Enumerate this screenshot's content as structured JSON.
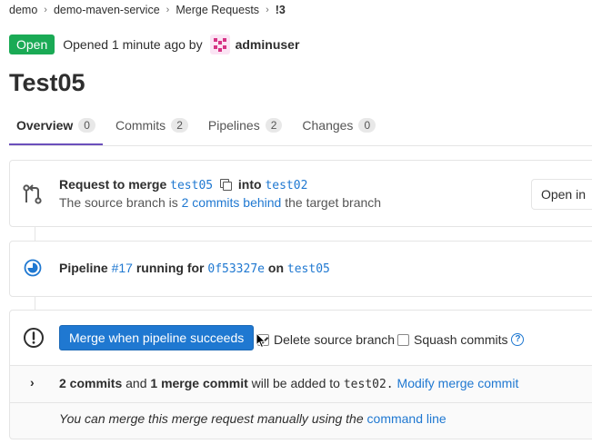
{
  "breadcrumbs": [
    "demo",
    "demo-maven-service",
    "Merge Requests",
    "!3"
  ],
  "status": {
    "badge": "Open",
    "opened_text": "Opened 1 minute ago by",
    "author": "adminuser"
  },
  "title": "Test05",
  "tabs": [
    {
      "label": "Overview",
      "count": "0"
    },
    {
      "label": "Commits",
      "count": "2"
    },
    {
      "label": "Pipelines",
      "count": "2"
    },
    {
      "label": "Changes",
      "count": "0"
    }
  ],
  "merge_request": {
    "request_to_merge": "Request to merge",
    "source_branch": "test05",
    "into": "into",
    "target_branch": "test02",
    "behind_prefix": "The source branch is",
    "behind_link": "2 commits behind",
    "behind_suffix": "the target branch",
    "open_in_button": "Open in"
  },
  "pipeline": {
    "prefix": "Pipeline",
    "id": "#17",
    "running_for": "running for",
    "commit": "0f53327e",
    "on": "on",
    "branch": "test05"
  },
  "merge_widget": {
    "merge_button": "Merge when pipeline succeeds",
    "delete_source_branch": "Delete source branch",
    "delete_source_checked": true,
    "squash_commits": "Squash commits",
    "squash_checked": false,
    "commits_count": "2 commits",
    "and": "and",
    "merge_commit": "1 merge commit",
    "will_be_added": "will be added to",
    "target": "test02.",
    "modify_link": "Modify merge commit",
    "manual_text": "You can merge this merge request manually using the",
    "command_line_link": "command line"
  },
  "colors": {
    "open_badge": "#1aaa55",
    "primary": "#1f78d1",
    "active_tab": "#6b4fbb"
  }
}
